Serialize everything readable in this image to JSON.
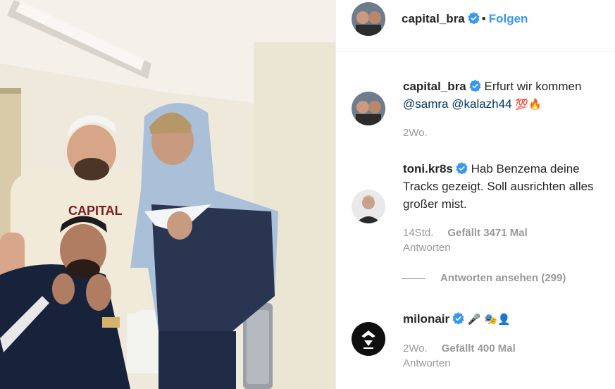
{
  "post": {
    "username": "capital_bra",
    "follow_label": "Folgen",
    "dot": "•"
  },
  "caption": {
    "username": "capital_bra",
    "text": "Erfurt wir kommen",
    "mention1": "@samra",
    "mention2": "@kalazh44",
    "emoji": "💯🔥",
    "time": "2Wo."
  },
  "comments": [
    {
      "username": "toni.kr8s",
      "text": "Hab Benzema deine Tracks gezeigt. Soll ausrichten alles großer mist.",
      "time": "14Std.",
      "likes": "Gefällt 3471 Mal",
      "reply_label": "Antworten",
      "view_replies": "Antworten ansehen (299)"
    },
    {
      "username": "milonair",
      "text": "🎤 🎭👤",
      "time": "2Wo.",
      "likes": "Gefällt 400 Mal",
      "reply_label": "Antworten"
    }
  ],
  "photo": {
    "shirt_text": "CAPITAL"
  },
  "colors": {
    "link": "#3897f0",
    "mention": "#003569",
    "muted": "#999999",
    "verified": "#3897f0"
  }
}
